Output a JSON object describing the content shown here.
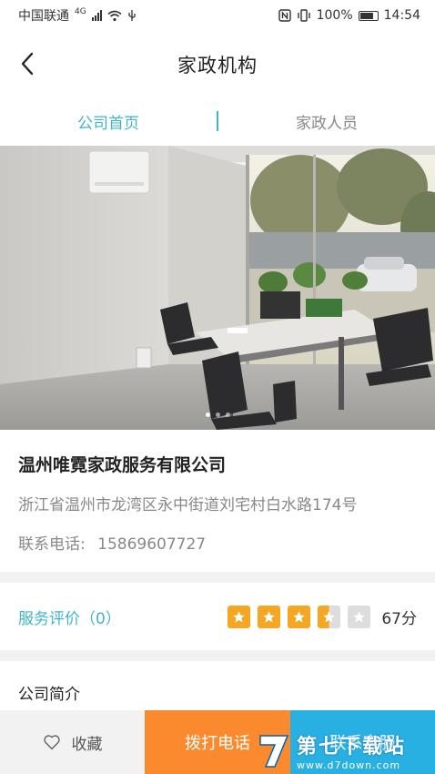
{
  "status_bar": {
    "carrier": "中国联通",
    "network": "4G",
    "battery": "100%",
    "time": "14:54"
  },
  "nav": {
    "title": "家政机构",
    "back_icon": "chevron-left-icon"
  },
  "tabs": [
    {
      "label": "公司首页",
      "active": true
    },
    {
      "label": "家政人员",
      "active": false
    }
  ],
  "banner": {
    "dots": 3,
    "active_dot": 1
  },
  "company": {
    "name": "温州唯霓家政服务有限公司",
    "address": "浙江省温州市龙湾区永中街道刘宅村白水路174号",
    "phone_label": "联系电话:",
    "phone": "15869607727"
  },
  "rating": {
    "label": "服务评价（0）",
    "stars_value": 3.5,
    "stars_max": 5,
    "score": "67分"
  },
  "intro": {
    "title": "公司简介"
  },
  "bottom_bar": {
    "favorite_label": "收藏",
    "favorite_icon": "heart-icon",
    "call_label": "拨打电话",
    "contact_label": "联系客服"
  },
  "watermark": {
    "title": "第七下载站",
    "url": "www.d7down.com"
  },
  "colors": {
    "accent": "#3fb6c8",
    "star": "#f5a623",
    "call_button": "#fb8a2e",
    "contact_button": "#29b0e3"
  }
}
